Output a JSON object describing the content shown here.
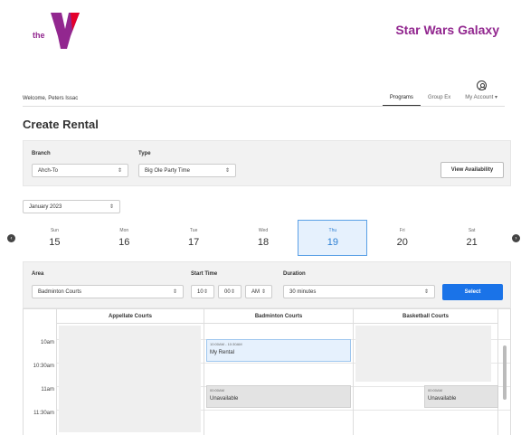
{
  "brand": {
    "logo_text": "the",
    "site_name": "Star Wars Galaxy",
    "accent_color": "#92278f"
  },
  "user": {
    "welcome": "Welcome, Peters Issac"
  },
  "nav": {
    "items": [
      {
        "label": "Programs",
        "active": true
      },
      {
        "label": "Group Ex",
        "active": false
      },
      {
        "label": "My Account ▾",
        "active": false
      }
    ],
    "account_icon": "user-circle-icon"
  },
  "page": {
    "title": "Create Rental"
  },
  "filters": {
    "branch_label": "Branch",
    "branch_value": "Ahch-To",
    "type_label": "Type",
    "type_value": "Big Ole Party Time",
    "view_availability_label": "View Availability"
  },
  "calendar": {
    "month_value": "January 2023",
    "prev_icon": "chevron-left-icon",
    "next_icon": "chevron-right-icon",
    "days": [
      {
        "name": "Sun",
        "num": "15"
      },
      {
        "name": "Mon",
        "num": "16"
      },
      {
        "name": "Tue",
        "num": "17"
      },
      {
        "name": "Wed",
        "num": "18"
      },
      {
        "name": "Thu",
        "num": "19",
        "selected": true
      },
      {
        "name": "Fri",
        "num": "20"
      },
      {
        "name": "Sat",
        "num": "21"
      }
    ],
    "selected_color": "#2d7fd3"
  },
  "options": {
    "area_label": "Area",
    "area_value": "Badminton Courts",
    "start_time_label": "Start Time",
    "hour_value": "10",
    "minute_value": "00",
    "ampm_value": "AM",
    "duration_label": "Duration",
    "duration_value": "30 minutes",
    "select_label": "Select"
  },
  "schedule": {
    "courts": [
      "Appellate Courts",
      "Badminton Courts",
      "Basketball Courts"
    ],
    "time_labels": [
      "10am",
      "10:30am",
      "11am",
      "11:30am"
    ],
    "my_rental": {
      "time": "10:00AM - 10:30AM",
      "label": "My Rental"
    },
    "unavailable": [
      {
        "time": "00:00AM",
        "label": "Unavailable"
      },
      {
        "time": "00:00AM",
        "label": "Unavailable"
      }
    ]
  }
}
